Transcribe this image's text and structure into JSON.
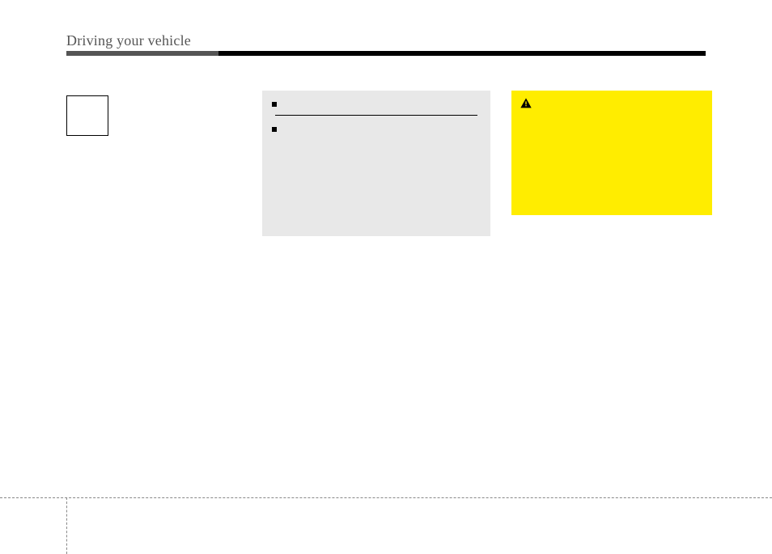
{
  "header": {
    "section": "Driving your vehicle"
  },
  "left": {
    "heading": "",
    "body": ""
  },
  "middle": {
    "item1": {
      "title": "",
      "subtitle": "",
      "body": ""
    },
    "item2": {
      "title": "",
      "body": ""
    }
  },
  "right": {
    "caution_label": "",
    "caution_body": ""
  }
}
